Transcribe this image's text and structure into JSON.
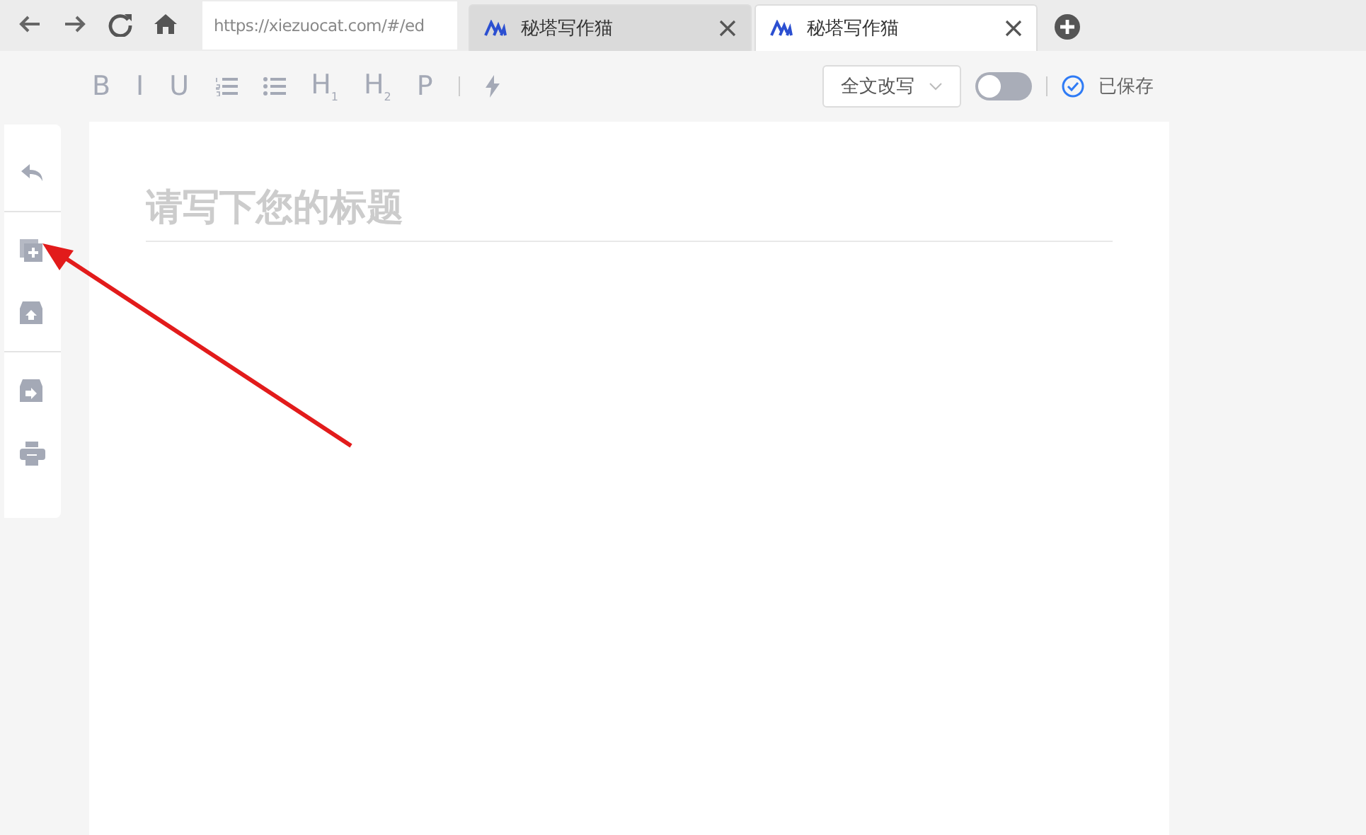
{
  "browser": {
    "url": "https://xiezuocat.com/#/ed",
    "tabs": [
      {
        "title": "秘塔写作猫",
        "selected": false
      },
      {
        "title": "秘塔写作猫",
        "selected": true
      }
    ]
  },
  "toolbar": {
    "items": [
      {
        "kind": "text",
        "label": "B"
      },
      {
        "kind": "text",
        "label": "I"
      },
      {
        "kind": "text",
        "label": "U"
      },
      {
        "kind": "olist"
      },
      {
        "kind": "ulist"
      },
      {
        "kind": "text",
        "label": "H$_{1}$"
      },
      {
        "kind": "text",
        "label": "H$_{2}$"
      },
      {
        "kind": "text",
        "label": "P"
      },
      {
        "kind": "separator"
      },
      {
        "kind": "bolt"
      }
    ],
    "mode_dropdown": "全文改写",
    "toggle": {
      "on": false
    },
    "save_status": "已保存"
  },
  "sidebar": {
    "items": [
      {
        "kind": "undo"
      },
      {
        "kind": "new"
      },
      {
        "kind": "upload"
      },
      {
        "kind": "export"
      },
      {
        "kind": "print"
      }
    ]
  },
  "editor": {
    "title_placeholder": "请写下您的标题"
  }
}
